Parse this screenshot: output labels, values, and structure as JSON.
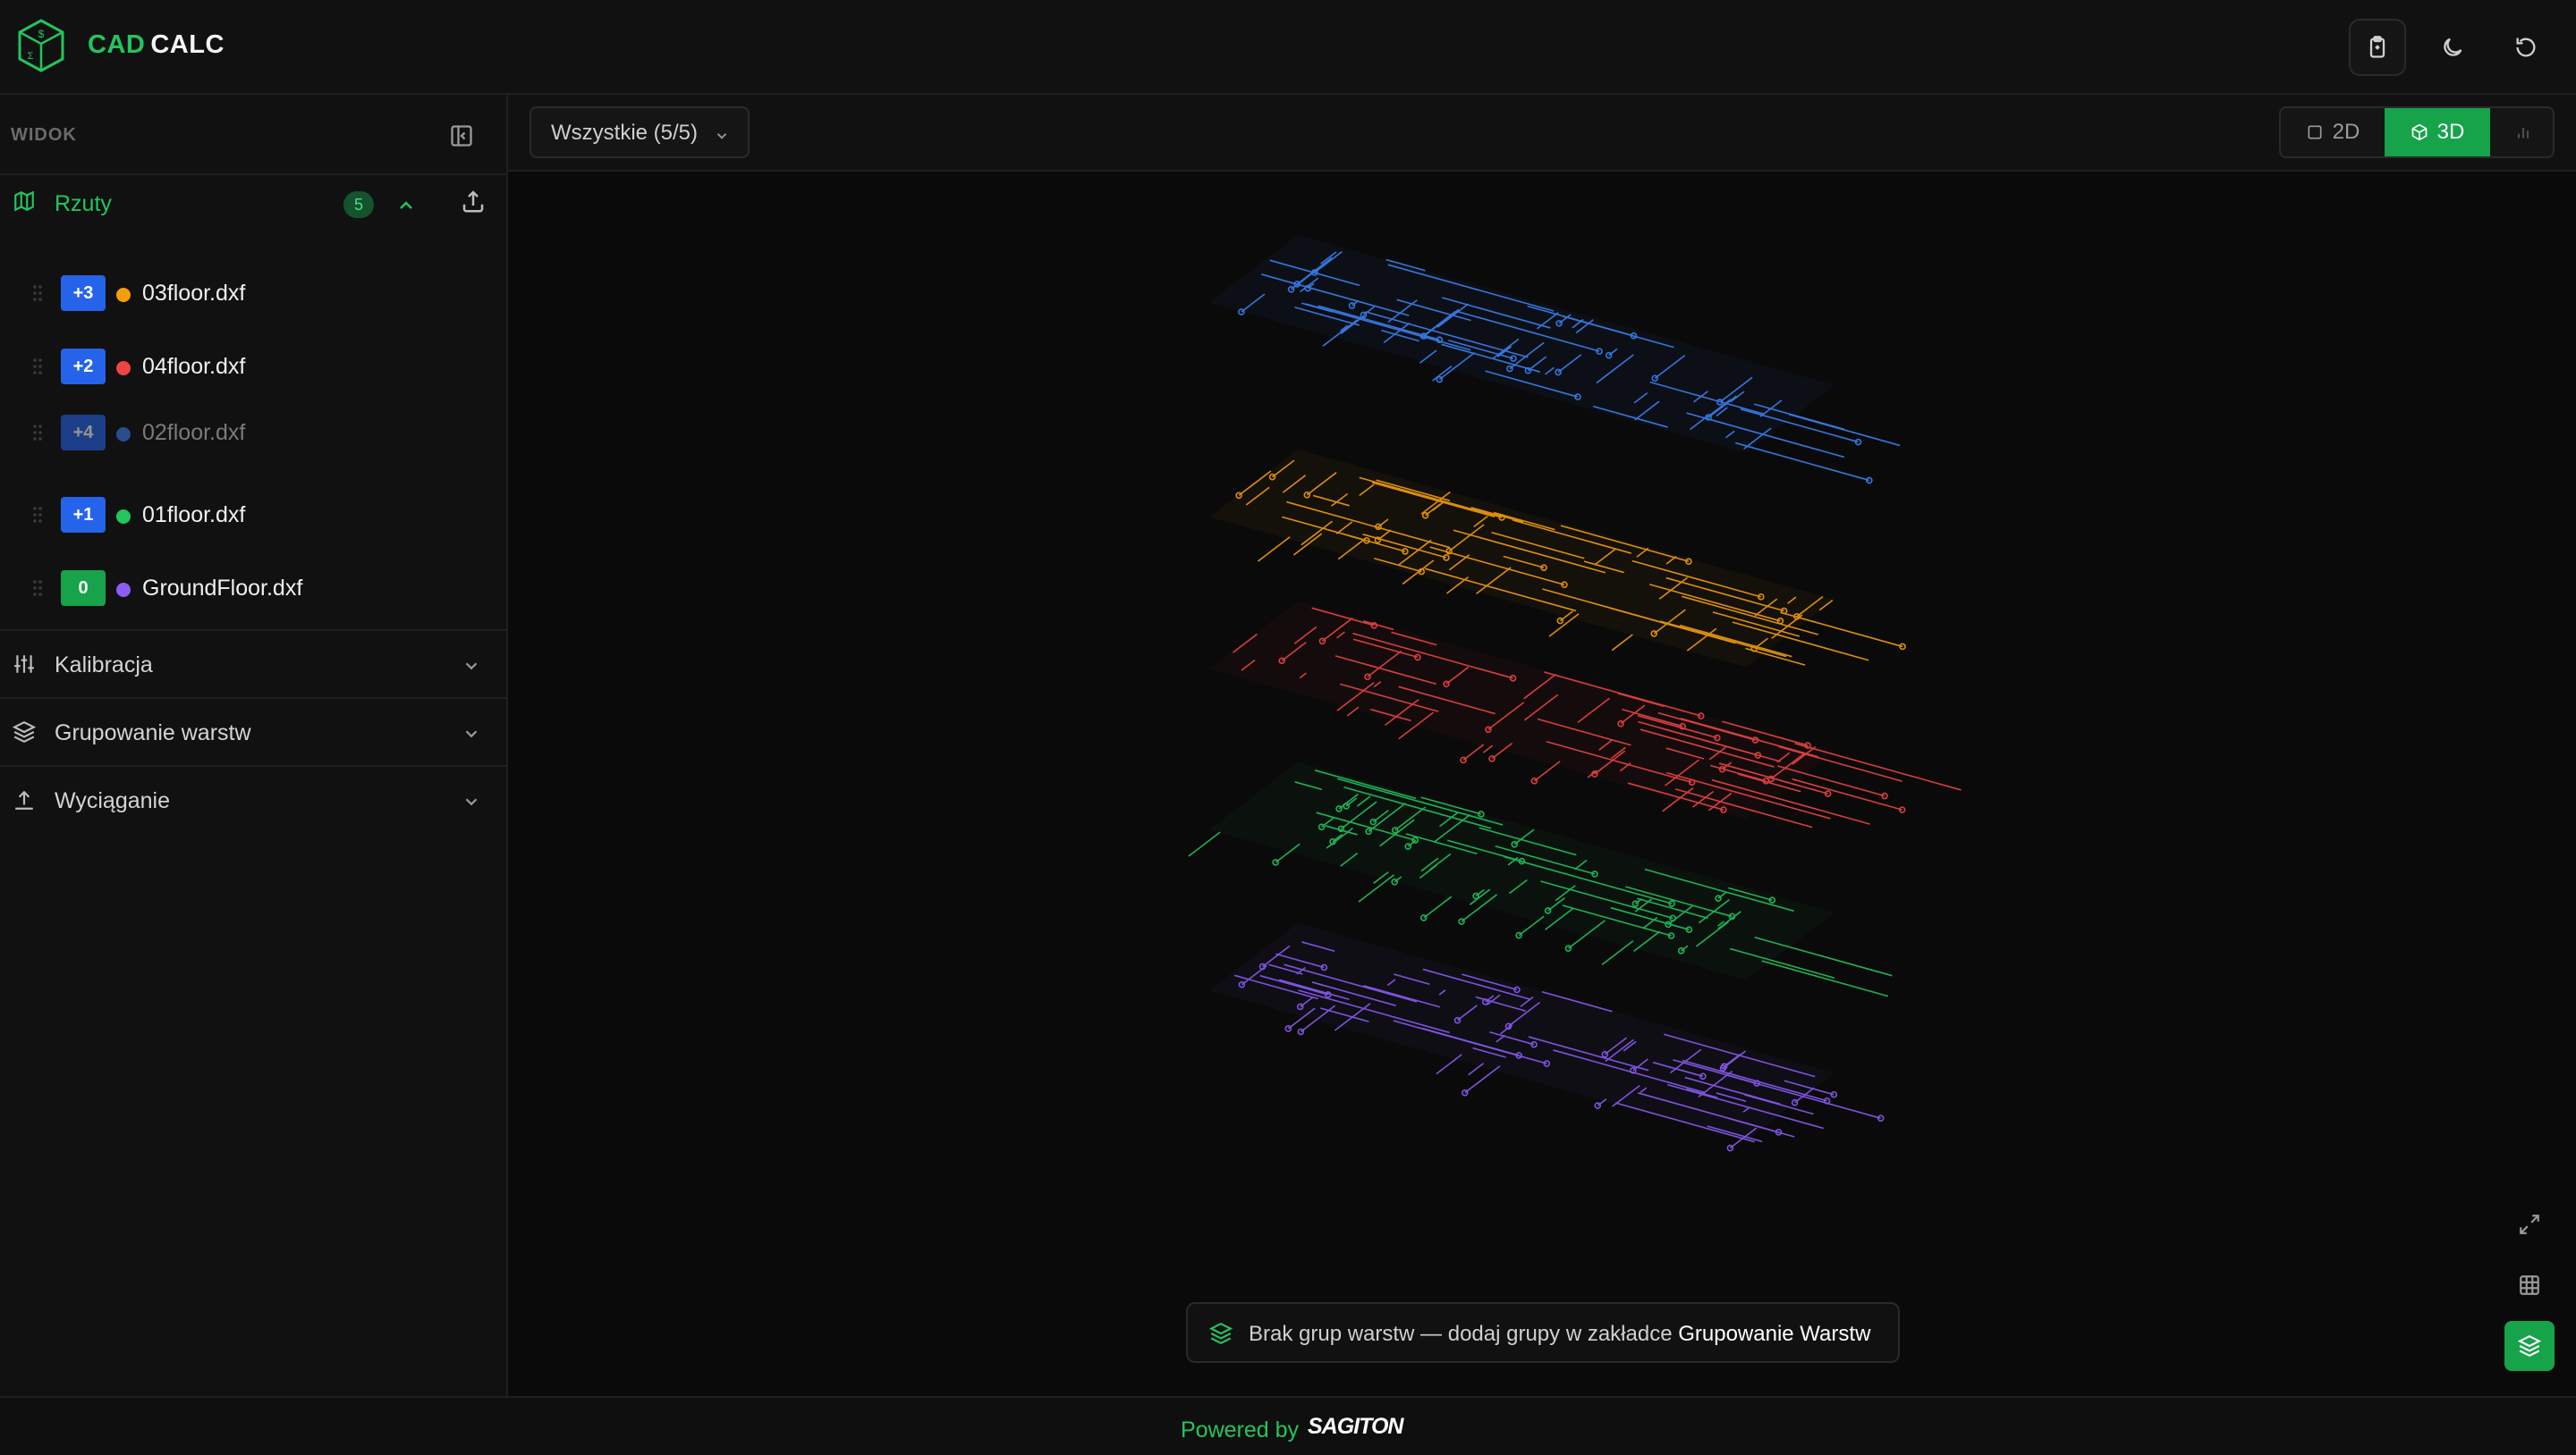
{
  "app": {
    "brand_part1": "CAD",
    "brand_part2": "CALC"
  },
  "sidebar": {
    "header_label": "WIDOK",
    "rzuty": {
      "title": "Rzuty",
      "count": "5",
      "files": [
        {
          "level": "+3",
          "name": "03floor.dxf",
          "level_color": "#2563eb",
          "dot_color": "#f59e0b",
          "dimmed": false
        },
        {
          "level": "+2",
          "name": "04floor.dxf",
          "level_color": "#2563eb",
          "dot_color": "#ef4444",
          "dimmed": false
        },
        {
          "level": "+4",
          "name": "02floor.dxf",
          "level_color": "#2563eb",
          "dot_color": "#3b82f6",
          "dimmed": true
        },
        {
          "level": "+1",
          "name": "01floor.dxf",
          "level_color": "#2563eb",
          "dot_color": "#22c55e",
          "dimmed": false
        },
        {
          "level": "0",
          "name": "GroundFloor.dxf",
          "level_color": "#16a34a",
          "dot_color": "#8b5cf6",
          "dimmed": false
        }
      ]
    },
    "sections": {
      "kalibracja": "Kalibracja",
      "grupowanie": "Grupowanie warstw",
      "wyciaganie": "Wyciąganie"
    }
  },
  "main": {
    "filter_label": "Wszystkie (5/5)",
    "view": {
      "btn_2d": "2D",
      "btn_3d": "3D",
      "active": "3D"
    },
    "layers": [
      {
        "file": "02floor.dxf",
        "color": "#3b82f6"
      },
      {
        "file": "03floor.dxf",
        "color": "#f59e0b"
      },
      {
        "file": "04floor.dxf",
        "color": "#ef4444"
      },
      {
        "file": "01floor.dxf",
        "color": "#22c55e"
      },
      {
        "file": "GroundFloor.dxf",
        "color": "#8b5cf6"
      }
    ],
    "banner": {
      "text": "Brak grup warstw — dodaj grupy w zakładce",
      "link": "Grupowanie Warstw"
    }
  },
  "footer": {
    "powered_by": "Powered by",
    "brand": "SAGITON"
  },
  "colors": {
    "accent": "#22c55e",
    "accent_dark": "#16a34a",
    "background": "#0a0a0a",
    "panel": "#111111"
  }
}
